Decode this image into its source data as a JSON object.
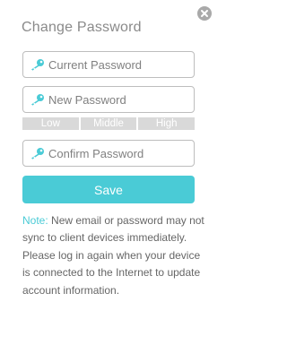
{
  "dialog": {
    "title": "Change Password"
  },
  "fields": {
    "current_password": {
      "placeholder": "Current Password",
      "value": ""
    },
    "new_password": {
      "placeholder": "New Password",
      "value": ""
    },
    "confirm_password": {
      "placeholder": "Confirm Password",
      "value": ""
    }
  },
  "strength": {
    "levels": [
      "Low",
      "Middle",
      "High"
    ]
  },
  "actions": {
    "save_label": "Save"
  },
  "note": {
    "label": "Note:",
    "text": " New email or password may not sync to client devices immediately. Please log in again when your device is connected to the Internet to update account information."
  },
  "icons": {
    "close": "close-icon",
    "key": "key-icon"
  },
  "colors": {
    "accent": "#4acbd6",
    "strength_bar": "#d9d9d9",
    "close_bg": "#a9a9a9"
  }
}
